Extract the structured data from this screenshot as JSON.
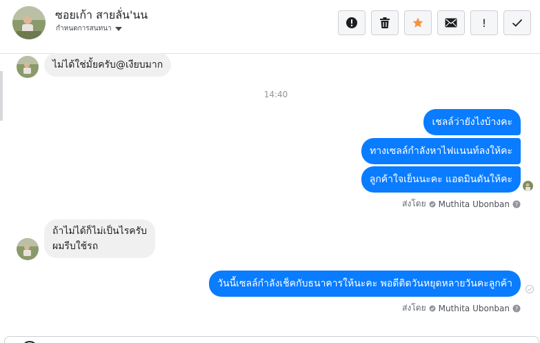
{
  "header": {
    "contact_name": "ซอยเก้า สายลั่น'นน",
    "assign_label": "กำหนดการสนทนา",
    "actions": [
      {
        "name": "spam-icon"
      },
      {
        "name": "trash-icon"
      },
      {
        "name": "star-icon",
        "color": "#f7923b"
      },
      {
        "name": "envelope-icon"
      },
      {
        "name": "exclamation-icon",
        "text": "!"
      },
      {
        "name": "checkmark-icon"
      }
    ]
  },
  "messages": {
    "in_1": "ไม่ได้ใช่มั้ยครับ@เงียบมาก",
    "timestamp": "14:40",
    "out_1": "เชลล์ว่ายังไงบ้างคะ",
    "out_2": "ทางเซลล์กำลังหาไฟแนนท์ลงให้คะ",
    "out_3": "ลูกค้าใจเย็นนะคะ แอดมินดันให้คะ",
    "sent_by_1": {
      "prefix": "ส่งโดย",
      "name": "Muthita Ubonban"
    },
    "in_2_line1": "ถ้าไม่ได้ก็ไม่เป็นไรครับ",
    "in_2_line2": "ผมรีบใช้รถ",
    "out_4": "วันนี้เซลล์กำลังเช็คกับธนาคารให้นะคะ พอดีติดวันหยุดหลายวันคะลูกค้า",
    "sent_by_2": {
      "prefix": "ส่งโดย",
      "name": "Muthita Ubonban"
    }
  },
  "colors": {
    "outgoing_bubble": "#0a7cff",
    "incoming_bubble": "#f0f0f0",
    "accent_star": "#f7923b"
  }
}
